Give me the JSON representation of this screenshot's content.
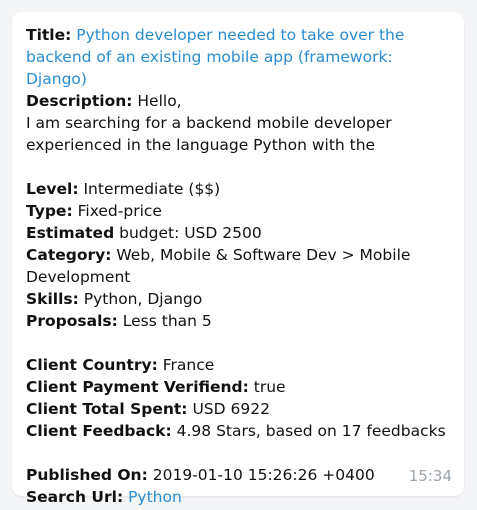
{
  "message": {
    "title_label": "Title:",
    "title_value": "Python developer needed to take over the backend of an existing mobile app (framework: Django)",
    "description_label": "Description:",
    "description_first": "Hello,",
    "description_rest": "I am searching for a backend mobile developer experienced in the language Python with the",
    "level_label": "Level:",
    "level_value": "Intermediate ($$)",
    "type_label": "Type:",
    "type_value": "Fixed-price",
    "estimated_label": "Estimated",
    "estimated_value": "budget: USD 2500",
    "category_label": "Category:",
    "category_value": "Web, Mobile & Software Dev > Mobile Development",
    "skills_label": "Skills:",
    "skills_value": "Python, Django",
    "proposals_label": "Proposals:",
    "proposals_value": "Less than 5",
    "client_country_label": "Client Country:",
    "client_country_value": "France",
    "client_payment_label": "Client Payment Verifiend:",
    "client_payment_value": "true",
    "client_spent_label": "Client Total Spent:",
    "client_spent_value": "USD 6922",
    "client_feedback_label": "Client Feedback:",
    "client_feedback_value": "4.98 Stars, based on 17 feedbacks",
    "published_label": "Published On:",
    "published_value": "2019-01-10 15:26:26 +0400",
    "search_label": "Search Url:",
    "search_value": "Python",
    "time": "15:34"
  },
  "colors": {
    "link": "#2b8ccf",
    "timestamp": "#9aa3ab",
    "background": "#f4f5f7",
    "bubble": "#ffffff"
  }
}
